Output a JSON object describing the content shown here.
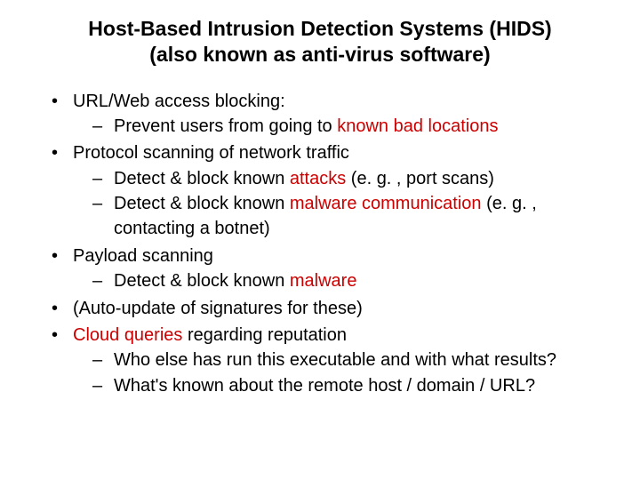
{
  "title_line1": "Host-Based Intrusion Detection Systems (HIDS)",
  "title_line2": "(also known as anti-virus software)",
  "b1": "URL/Web access blocking:",
  "b1s1a": "Prevent users from going to ",
  "b1s1h": "known bad locations",
  "b2": "Protocol scanning of network traffic",
  "b2s1a": "Detect & block known ",
  "b2s1h": "attacks",
  "b2s1b": " (e. g. , port scans)",
  "b2s2a": "Detect & block known ",
  "b2s2h": "malware communication",
  "b2s2b": " (e. g. , contacting a botnet)",
  "b3": "Payload scanning",
  "b3s1a": "Detect & block known ",
  "b3s1h": "malware",
  "b4": "(Auto-update of signatures for these)",
  "b5h": "Cloud queries",
  "b5a": " regarding reputation",
  "b5s1": "Who else has run this executable and with what results?",
  "b5s2": "What's known about the remote host / domain / URL?"
}
